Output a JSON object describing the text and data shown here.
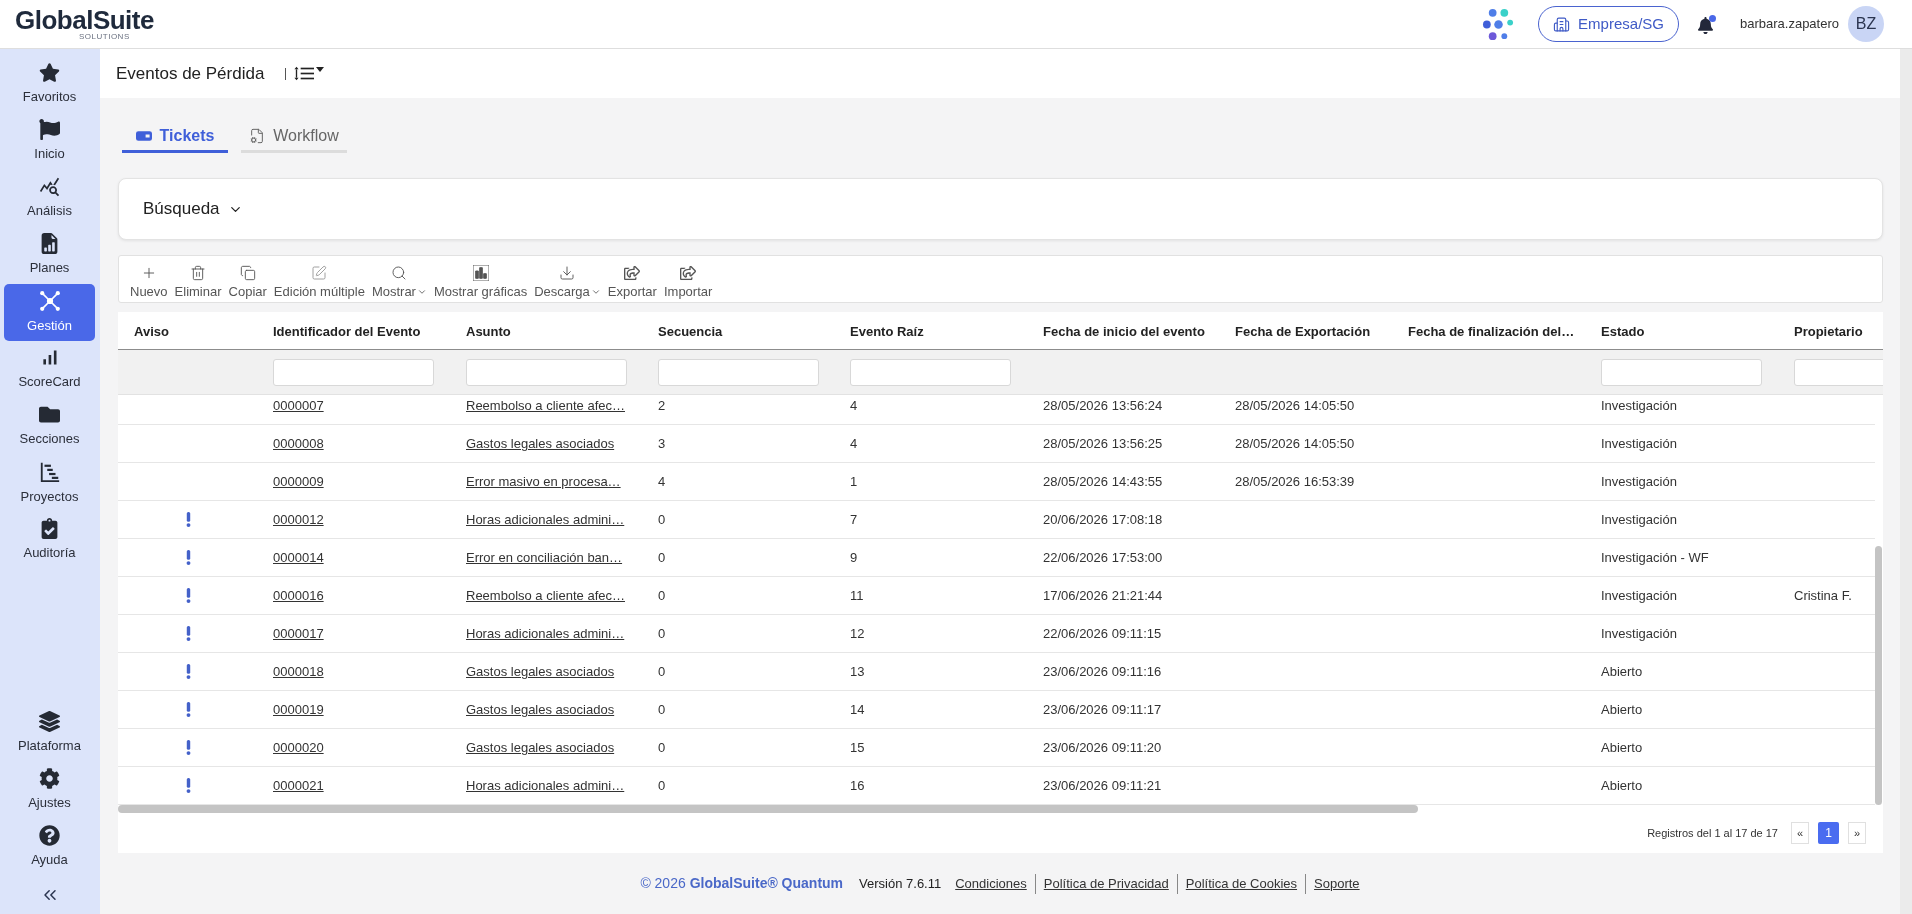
{
  "header": {
    "logo": {
      "name": "GlobalSuite",
      "tagline": "SOLUTIONS"
    },
    "company_button": "Empresa/SG",
    "notifications": {
      "unread": true
    },
    "user": {
      "name": "barbara.zapatero",
      "initials": "BZ"
    }
  },
  "sidebar": {
    "items": [
      {
        "label": "Favoritos",
        "selected": false
      },
      {
        "label": "Inicio",
        "selected": false
      },
      {
        "label": "Análisis",
        "selected": false
      },
      {
        "label": "Planes",
        "selected": false
      },
      {
        "label": "Gestión",
        "selected": true
      },
      {
        "label": "ScoreCard",
        "selected": false
      },
      {
        "label": "Secciones",
        "selected": false
      },
      {
        "label": "Proyectos",
        "selected": false
      },
      {
        "label": "Auditoría",
        "selected": false
      }
    ],
    "bottom_items": [
      {
        "label": "Plataforma",
        "selected": false
      },
      {
        "label": "Ajustes",
        "selected": false
      },
      {
        "label": "Ayuda",
        "selected": false
      }
    ]
  },
  "page": {
    "title": "Eventos de Pérdida"
  },
  "tabs": [
    {
      "label": "Tickets",
      "selected": true
    },
    {
      "label": "Workflow",
      "selected": false
    }
  ],
  "search_panel": {
    "label": "Búsqueda",
    "expanded": false
  },
  "toolbar": [
    {
      "label": "Nuevo",
      "dropdown": false
    },
    {
      "label": "Eliminar",
      "dropdown": false
    },
    {
      "label": "Copiar",
      "dropdown": false
    },
    {
      "label": "Edición múltiple",
      "dropdown": false
    },
    {
      "label": "Mostrar",
      "dropdown": true
    },
    {
      "label": "Mostrar gráficas",
      "dropdown": false
    },
    {
      "label": "Descarga",
      "dropdown": true
    },
    {
      "label": "Exportar",
      "dropdown": false
    },
    {
      "label": "Importar",
      "dropdown": false
    }
  ],
  "table": {
    "columns": [
      {
        "label": "Aviso",
        "filter": false
      },
      {
        "label": "Identificador del Evento",
        "filter": true
      },
      {
        "label": "Asunto",
        "filter": true
      },
      {
        "label": "Secuencia",
        "filter": true
      },
      {
        "label": "Evento Raíz",
        "filter": true
      },
      {
        "label": "Fecha de inicio del evento",
        "filter": false
      },
      {
        "label": "Fecha de Exportación",
        "filter": false
      },
      {
        "label": "Fecha de finalización del…",
        "filter": false
      },
      {
        "label": "Estado",
        "filter": true
      },
      {
        "label": "Propietario",
        "filter": true
      }
    ],
    "rows": [
      {
        "alert": false,
        "event_id": "0000007",
        "subject": "Reembolso a cliente afec…",
        "sequence": "2",
        "root_event": "4",
        "start_date": "28/05/2026 13:56:24",
        "export_date": "28/05/2026 14:05:50",
        "status": "Investigación"
      },
      {
        "alert": false,
        "event_id": "0000008",
        "subject": "Gastos legales asociados",
        "sequence": "3",
        "root_event": "4",
        "start_date": "28/05/2026 13:56:25",
        "export_date": "28/05/2026 14:05:50",
        "status": "Investigación"
      },
      {
        "alert": false,
        "event_id": "0000009",
        "subject": "Error masivo en procesa…",
        "sequence": "4",
        "root_event": "1",
        "start_date": "28/05/2026 14:43:55",
        "export_date": "28/05/2026 16:53:39",
        "status": "Investigación"
      },
      {
        "alert": true,
        "event_id": "0000012",
        "subject": "Horas adicionales admini…",
        "sequence": "0",
        "root_event": "7",
        "start_date": "20/06/2026 17:08:18",
        "status": "Investigación"
      },
      {
        "alert": true,
        "event_id": "0000014",
        "subject": "Error en conciliación ban…",
        "sequence": "0",
        "root_event": "9",
        "start_date": "22/06/2026 17:53:00",
        "status": "Investigación - WF"
      },
      {
        "alert": true,
        "event_id": "0000016",
        "subject": "Reembolso a cliente afec…",
        "sequence": "0",
        "root_event": "11",
        "start_date": "17/06/2026 21:21:44",
        "status": "Investigación",
        "owner": "Cristina F."
      },
      {
        "alert": true,
        "event_id": "0000017",
        "subject": "Horas adicionales admini…",
        "sequence": "0",
        "root_event": "12",
        "start_date": "22/06/2026 09:11:15",
        "status": "Investigación"
      },
      {
        "alert": true,
        "event_id": "0000018",
        "subject": "Gastos legales asociados",
        "sequence": "0",
        "root_event": "13",
        "start_date": "23/06/2026 09:11:16",
        "status": "Abierto"
      },
      {
        "alert": true,
        "event_id": "0000019",
        "subject": "Gastos legales asociados",
        "sequence": "0",
        "root_event": "14",
        "start_date": "23/06/2026 09:11:17",
        "status": "Abierto"
      },
      {
        "alert": true,
        "event_id": "0000020",
        "subject": "Gastos legales asociados",
        "sequence": "0",
        "root_event": "15",
        "start_date": "23/06/2026 09:11:20",
        "status": "Abierto"
      },
      {
        "alert": true,
        "event_id": "0000021",
        "subject": "Horas adicionales admini…",
        "sequence": "0",
        "root_event": "16",
        "start_date": "23/06/2026 09:11:21",
        "status": "Abierto"
      }
    ]
  },
  "pagination": {
    "summary": "Registros del 1 al 17 de 17",
    "prev": "«",
    "next": "»",
    "pages": [
      {
        "label": "1",
        "selected": true
      }
    ]
  },
  "footer": {
    "copyright": "© 2026 **GlobalSuite® Quantum**",
    "version": "Versión 7.6.11",
    "links": [
      "Condiciones",
      "Política de Privacidad",
      "Política de Cookies",
      "Soporte"
    ]
  }
}
